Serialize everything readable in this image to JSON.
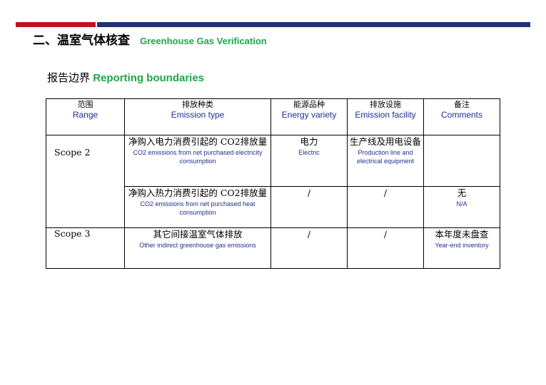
{
  "header": {
    "title_cn": "二、温室气体核查",
    "title_en": "Greenhouse Gas Verification"
  },
  "section": {
    "label_cn": "报告边界",
    "label_en": "Reporting boundaries"
  },
  "table": {
    "headers": [
      {
        "cn": "范围",
        "en": "Range"
      },
      {
        "cn": "排放种类",
        "en": "Emission type"
      },
      {
        "cn": "能源品种",
        "en": "Energy variety"
      },
      {
        "cn": "排放设施",
        "en": "Emission facility"
      },
      {
        "cn": "备注",
        "en": "Comments"
      }
    ],
    "scope2": {
      "label": "Scope 2",
      "row1": {
        "type_cn": "净购入电力消费引起的 CO2排放量",
        "type_en": "CO2 emissions from net purchased electricity consumption",
        "energy_cn": "电力",
        "energy_en": "Electric",
        "facility_cn": "生产线及用电设备",
        "facility_en": "Production line and electrical equipment",
        "comment_cn": "",
        "comment_en": ""
      },
      "row2": {
        "type_cn": "净购入热力消费引起的 CO2排放量",
        "type_en": "CO2 emissions from net purchased heat consumption",
        "energy": "/",
        "facility": "/",
        "comment_cn": "无",
        "comment_en": "N/A"
      }
    },
    "scope3": {
      "label": "Scope 3",
      "type_cn": "其它间接温室气体排放",
      "type_en": "Other indirect greenhouse gas emissions",
      "energy": "/",
      "facility": "/",
      "comment_cn": "本年度未盘查",
      "comment_en": "Year-end inventory"
    }
  },
  "colors": {
    "bar_red": "#c0141c",
    "bar_blue": "#1f2f7a",
    "accent_green": "#1aa84a",
    "english_blue": "#1f2f8f"
  }
}
